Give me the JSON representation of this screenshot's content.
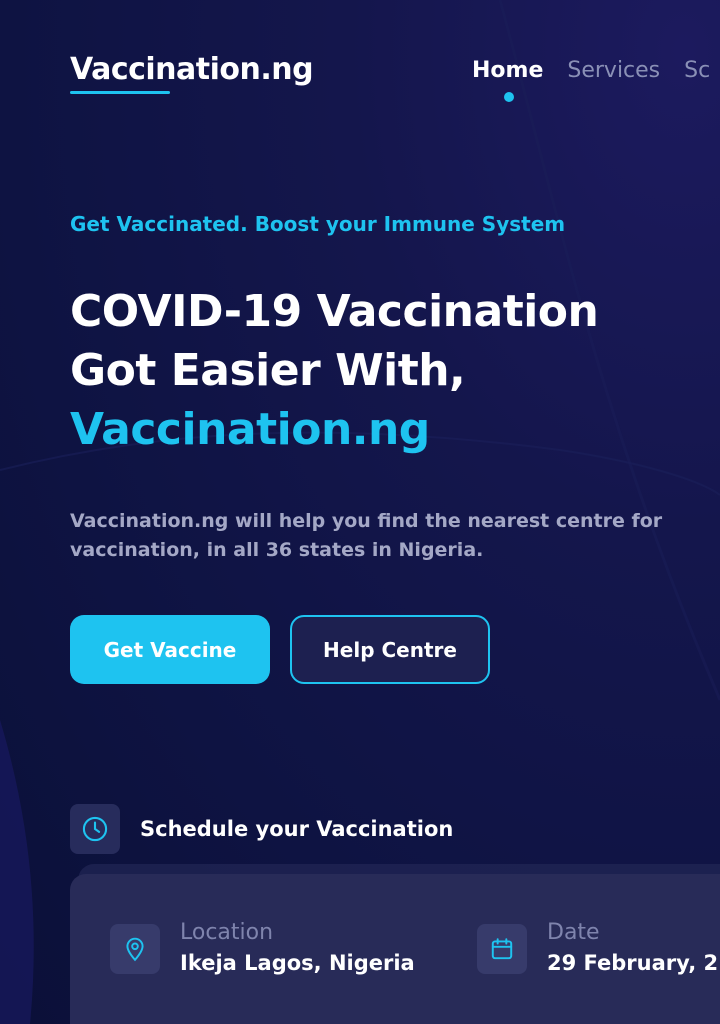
{
  "header": {
    "logo": "Vaccination.ng",
    "nav": [
      {
        "label": "Home",
        "active": true
      },
      {
        "label": "Services",
        "active": false
      },
      {
        "label": "Sc",
        "active": false
      }
    ]
  },
  "hero": {
    "tagline": "Get Vaccinated. Boost your Immune System",
    "title_line1": "COVID-19 Vaccination",
    "title_line2": "Got Easier With,",
    "title_accent": "Vaccination.ng",
    "description": "Vaccination.ng will help you find the nearest centre for vaccination, in all 36 states in Nigeria.",
    "primary_button": "Get Vaccine",
    "secondary_button": "Help Centre"
  },
  "schedule": {
    "label": "Schedule your Vaccination",
    "location": {
      "label": "Location",
      "value": "Ikeja Lagos, Nigeria"
    },
    "date": {
      "label": "Date",
      "value": "29 February, 2"
    }
  },
  "colors": {
    "accent": "#1ec3f0",
    "background": "#0e1342",
    "card": "#282b58"
  },
  "icons": {
    "schedule": "clock-icon",
    "location": "location-pin-icon",
    "date": "calendar-icon"
  }
}
